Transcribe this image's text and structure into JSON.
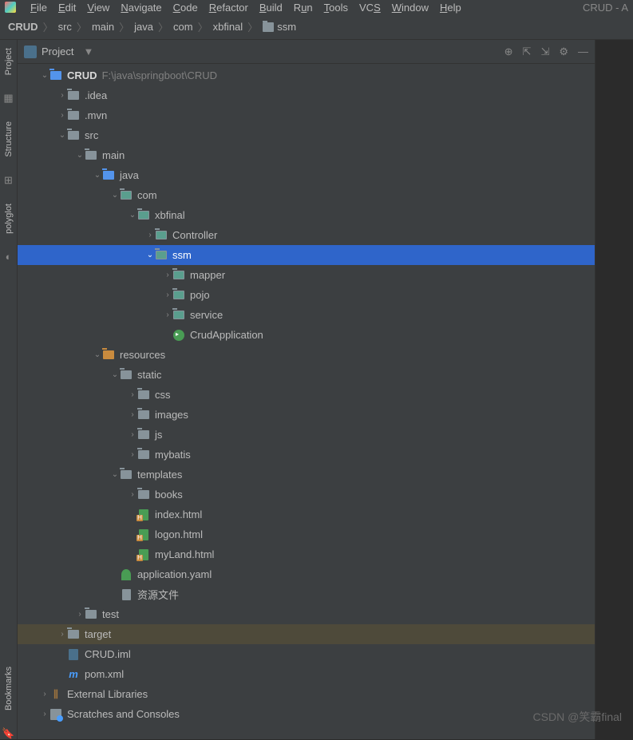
{
  "menu": {
    "file": "File",
    "edit": "Edit",
    "view": "View",
    "navigate": "Navigate",
    "code": "Code",
    "refactor": "Refactor",
    "build": "Build",
    "run": "Run",
    "tools": "Tools",
    "vcs": "VCS",
    "window": "Window",
    "help": "Help",
    "right": "CRUD - A"
  },
  "breadcrumb": {
    "items": [
      "CRUD",
      "src",
      "main",
      "java",
      "com",
      "xbfinal",
      "ssm"
    ]
  },
  "panel": {
    "title": "Project"
  },
  "leftbar": {
    "project": "Project",
    "structure": "Structure",
    "polyglot": "polyglot",
    "bookmarks": "Bookmarks"
  },
  "tree": [
    {
      "depth": 0,
      "arrow": "v",
      "icon": "folder-blue",
      "label": "CRUD",
      "bold": true,
      "path": "F:\\java\\springboot\\CRUD"
    },
    {
      "depth": 1,
      "arrow": ">",
      "icon": "folder",
      "label": ".idea"
    },
    {
      "depth": 1,
      "arrow": ">",
      "icon": "folder",
      "label": ".mvn"
    },
    {
      "depth": 1,
      "arrow": "v",
      "icon": "folder",
      "label": "src"
    },
    {
      "depth": 2,
      "arrow": "v",
      "icon": "folder",
      "label": "main"
    },
    {
      "depth": 3,
      "arrow": "v",
      "icon": "folder-blue",
      "label": "java"
    },
    {
      "depth": 4,
      "arrow": "v",
      "icon": "folder-teal",
      "label": "com"
    },
    {
      "depth": 5,
      "arrow": "v",
      "icon": "folder-teal",
      "label": "xbfinal"
    },
    {
      "depth": 6,
      "arrow": ">",
      "icon": "folder-teal",
      "label": "Controller"
    },
    {
      "depth": 6,
      "arrow": "v",
      "icon": "folder-teal",
      "label": "ssm",
      "selected": true
    },
    {
      "depth": 7,
      "arrow": ">",
      "icon": "folder-teal",
      "label": "mapper"
    },
    {
      "depth": 7,
      "arrow": ">",
      "icon": "folder-teal",
      "label": "pojo"
    },
    {
      "depth": 7,
      "arrow": ">",
      "icon": "folder-teal",
      "label": "service"
    },
    {
      "depth": 7,
      "arrow": "",
      "icon": "java",
      "label": "CrudApplication"
    },
    {
      "depth": 3,
      "arrow": "v",
      "icon": "folder-orange",
      "label": "resources"
    },
    {
      "depth": 4,
      "arrow": "v",
      "icon": "folder",
      "label": "static"
    },
    {
      "depth": 5,
      "arrow": ">",
      "icon": "folder",
      "label": "css"
    },
    {
      "depth": 5,
      "arrow": ">",
      "icon": "folder",
      "label": "images"
    },
    {
      "depth": 5,
      "arrow": ">",
      "icon": "folder",
      "label": "js"
    },
    {
      "depth": 5,
      "arrow": ">",
      "icon": "folder",
      "label": "mybatis"
    },
    {
      "depth": 4,
      "arrow": "v",
      "icon": "folder",
      "label": "templates"
    },
    {
      "depth": 5,
      "arrow": ">",
      "icon": "folder",
      "label": "books"
    },
    {
      "depth": 5,
      "arrow": "",
      "icon": "html",
      "label": "index.html"
    },
    {
      "depth": 5,
      "arrow": "",
      "icon": "html",
      "label": "logon.html"
    },
    {
      "depth": 5,
      "arrow": "",
      "icon": "html",
      "label": "myLand.html"
    },
    {
      "depth": 4,
      "arrow": "",
      "icon": "yaml",
      "label": "application.yaml"
    },
    {
      "depth": 4,
      "arrow": "",
      "icon": "txt",
      "label": "资源文件"
    },
    {
      "depth": 2,
      "arrow": ">",
      "icon": "folder",
      "label": "test"
    },
    {
      "depth": 1,
      "arrow": ">",
      "icon": "folder",
      "label": "target",
      "highlighted": true
    },
    {
      "depth": 1,
      "arrow": "",
      "icon": "iml",
      "label": "CRUD.iml"
    },
    {
      "depth": 1,
      "arrow": "",
      "icon": "xml",
      "label": "pom.xml"
    },
    {
      "depth": 0,
      "arrow": ">",
      "icon": "lib",
      "label": "External Libraries"
    },
    {
      "depth": 0,
      "arrow": ">",
      "icon": "scratch",
      "label": "Scratches and Consoles"
    }
  ],
  "watermark": "CSDN @笑霸final"
}
